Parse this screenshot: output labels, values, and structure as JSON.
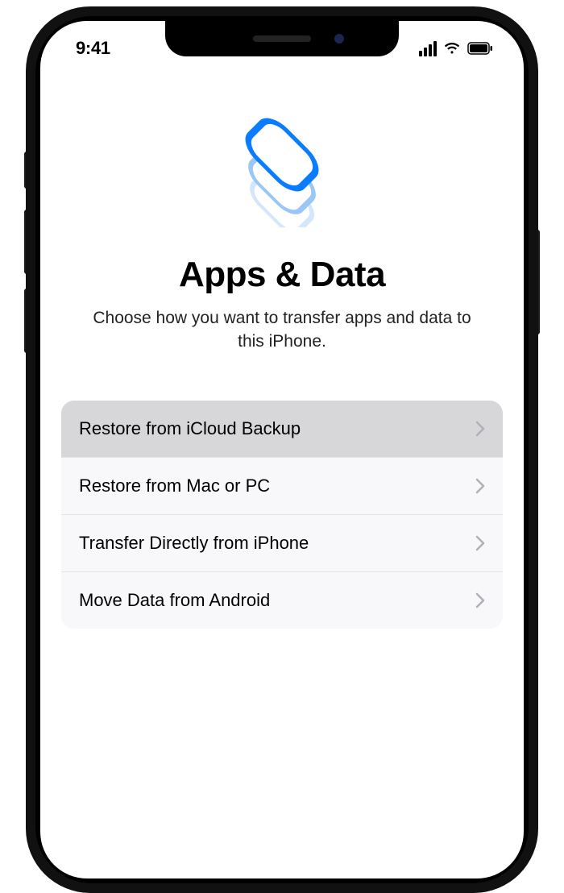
{
  "status": {
    "time": "9:41"
  },
  "page": {
    "title": "Apps & Data",
    "subtitle": "Choose how you want to transfer apps and data to this iPhone."
  },
  "options": [
    {
      "label": "Restore from iCloud Backup",
      "selected": true
    },
    {
      "label": "Restore from Mac or PC",
      "selected": false
    },
    {
      "label": "Transfer Directly from iPhone",
      "selected": false
    },
    {
      "label": "Move Data from Android",
      "selected": false
    }
  ],
  "colors": {
    "accent": "#0a7cff"
  }
}
